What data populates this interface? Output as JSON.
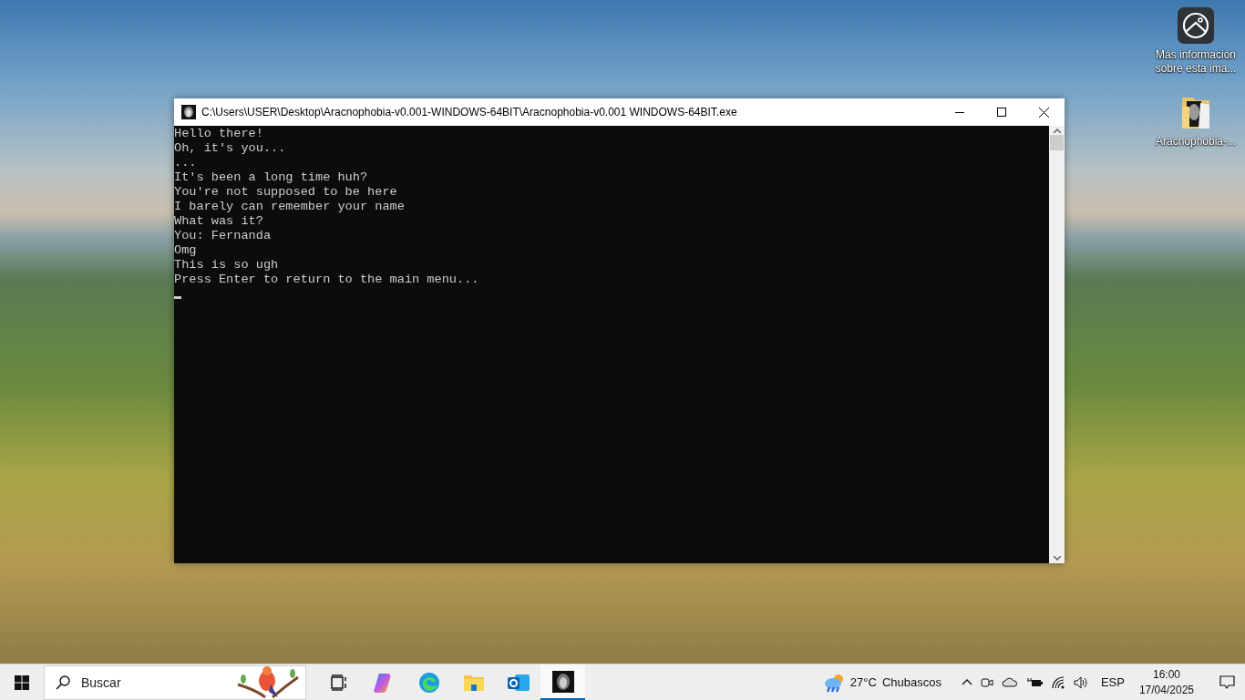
{
  "desktop_icons": [
    {
      "kind": "info",
      "label": "Más información sobre esta ima..."
    },
    {
      "kind": "folder",
      "label": "Aracnophobia-..."
    }
  ],
  "window": {
    "title": "C:\\Users\\USER\\Desktop\\Aracnophobia-v0.001-WINDOWS-64BIT\\Aracnophobia-v0.001 WINDOWS-64BIT.exe",
    "console_lines": [
      "Hello there!",
      "Oh, it's you...",
      "...",
      "It's been a long time huh?",
      "You're not supposed to be here",
      "I barely can remember your name",
      "What was it?",
      "You: Fernanda",
      "Omg",
      "This is so ugh",
      "Press Enter to return to the main menu..."
    ]
  },
  "taskbar": {
    "search": {
      "placeholder": "Buscar"
    },
    "apps": [
      {
        "kind": "taskview",
        "selected": false
      },
      {
        "kind": "copilot",
        "selected": false
      },
      {
        "kind": "browser",
        "selected": false
      },
      {
        "kind": "folder",
        "selected": false
      },
      {
        "kind": "mail",
        "selected": false
      },
      {
        "kind": "console",
        "selected": true
      }
    ],
    "weather": {
      "temperature": "27°C",
      "condition": "Chubascos"
    },
    "language": "ESP",
    "time": "16:00",
    "date": "17/04/2025"
  }
}
